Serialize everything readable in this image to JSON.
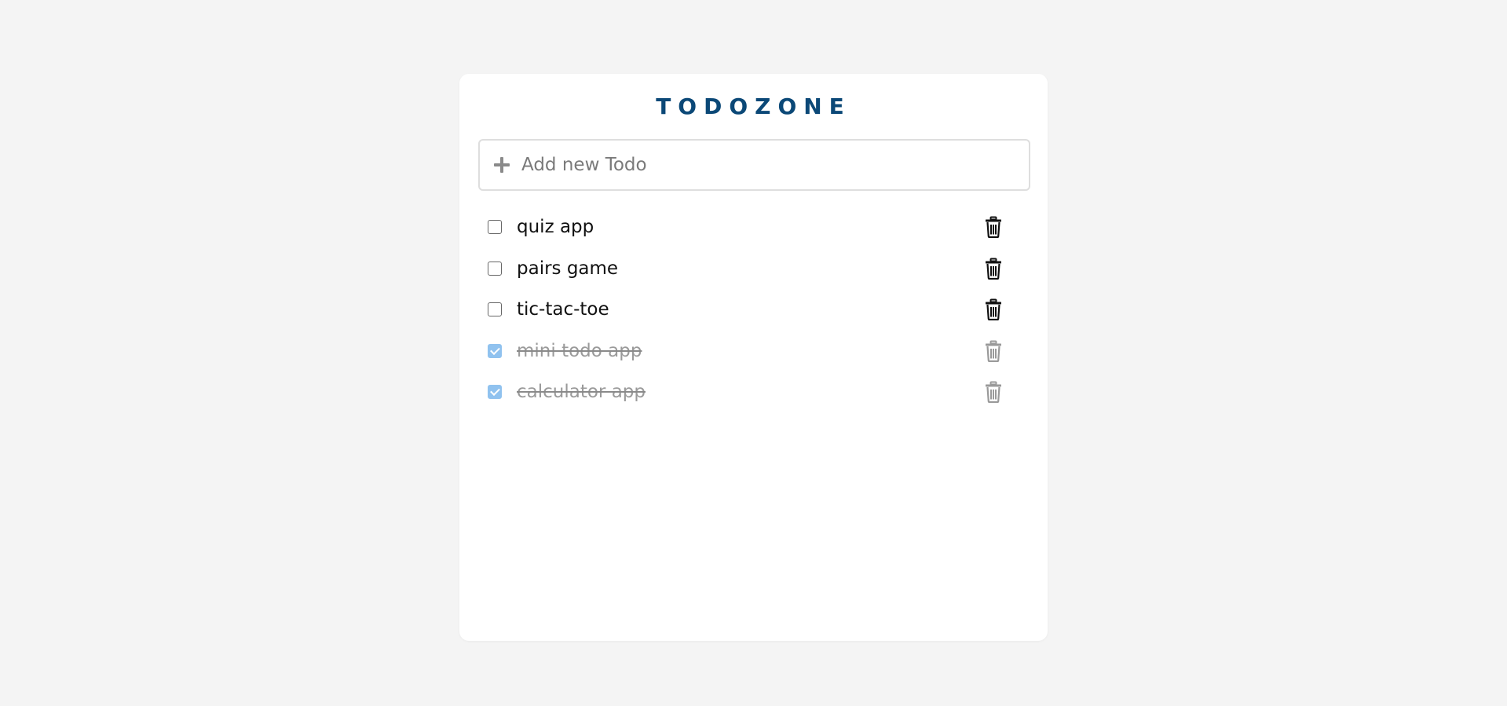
{
  "app": {
    "title": "TODOZONE"
  },
  "add_todo": {
    "placeholder": "Add new Todo",
    "value": "",
    "icon": "plus-icon"
  },
  "todos": [
    {
      "text": "quiz app",
      "completed": false
    },
    {
      "text": "pairs game",
      "completed": false
    },
    {
      "text": "tic-tac-toe",
      "completed": false
    },
    {
      "text": "mini todo app",
      "completed": true
    },
    {
      "text": "calculator app",
      "completed": true
    }
  ],
  "colors": {
    "title": "#0b4877",
    "checked": "#90c2ef",
    "completed_text": "#9a9a9a",
    "background": "#f4f4f4",
    "card": "#ffffff"
  },
  "icons": {
    "add": "plus-icon",
    "delete": "trash-icon"
  }
}
